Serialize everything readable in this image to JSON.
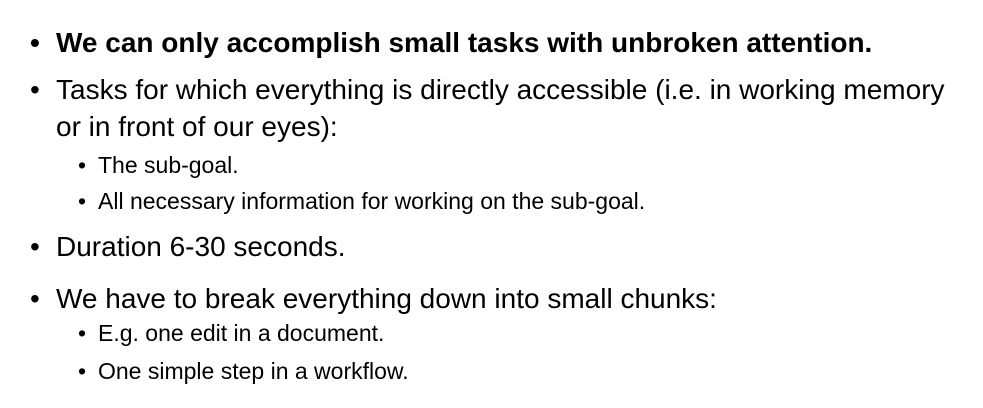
{
  "slide": {
    "bullet_char": "•",
    "items": [
      {
        "level": 1,
        "bold": true,
        "text": "We can only accomplish small tasks with unbroken attention."
      },
      {
        "level": 1,
        "bold": false,
        "text": "Tasks for which everything is directly accessible (i.e. in working memory or in front of our eyes):"
      },
      {
        "level": 2,
        "bold": false,
        "text": "The sub-goal."
      },
      {
        "level": 2,
        "bold": false,
        "text": "All necessary information for working on the sub-goal."
      },
      {
        "level": 1,
        "bold": false,
        "text": "Duration 6-30 seconds."
      },
      {
        "level": 1,
        "bold": false,
        "text": "We have to break everything down into small chunks:"
      },
      {
        "level": 2,
        "bold": false,
        "text": "E.g. one edit in a document."
      },
      {
        "level": 2,
        "bold": false,
        "text": "One simple step in a workflow."
      }
    ]
  }
}
